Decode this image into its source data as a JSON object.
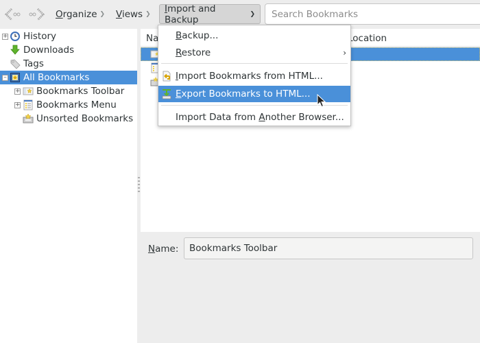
{
  "toolbar": {
    "back_icon": "back-arrow-icon",
    "forward_icon": "forward-arrow-icon",
    "organize": {
      "prefix": "",
      "accel": "O",
      "rest": "rganize"
    },
    "views": {
      "prefix": "",
      "accel": "V",
      "rest": "iews"
    },
    "import_backup": {
      "prefix": "",
      "accel": "I",
      "rest": "mport and Backup"
    },
    "search_placeholder": "Search Bookmarks",
    "search_value": ""
  },
  "sidebar": {
    "items": [
      {
        "label": "History",
        "icon": "clock-icon",
        "expandable": true
      },
      {
        "label": "Downloads",
        "icon": "download-arrow-icon",
        "expandable": false
      },
      {
        "label": "Tags",
        "icon": "tag-icon",
        "expandable": false
      },
      {
        "label": "All Bookmarks",
        "icon": "bookmarks-library-icon",
        "expandable": true,
        "expanded": true,
        "selected": true
      },
      {
        "label": "Bookmarks Toolbar",
        "icon": "bookmarks-toolbar-icon",
        "expandable": true
      },
      {
        "label": "Bookmarks Menu",
        "icon": "bookmarks-menu-icon",
        "expandable": true
      },
      {
        "label": "Unsorted Bookmarks",
        "icon": "unsorted-bookmarks-icon",
        "expandable": false
      }
    ]
  },
  "list": {
    "columns": {
      "name": "Name",
      "location": "Location"
    },
    "rows": [
      {
        "icon": "bookmarks-toolbar-icon",
        "selected": true
      },
      {
        "icon": "bookmarks-menu-icon",
        "selected": false
      },
      {
        "icon": "unsorted-bookmarks-icon",
        "selected": false
      }
    ]
  },
  "details": {
    "name_label": {
      "accel": "N",
      "rest": "ame:"
    },
    "name_value": "Bookmarks Toolbar"
  },
  "menu": {
    "items": [
      {
        "pre": "",
        "accel": "B",
        "post": "ackup...",
        "submenu": false
      },
      {
        "pre": "",
        "accel": "R",
        "post": "estore",
        "submenu": true,
        "arrow": "›"
      },
      {
        "pre": "",
        "accel": "I",
        "post": "mport Bookmarks from HTML...",
        "icon": "import-html-icon"
      },
      {
        "pre": "",
        "accel": "E",
        "post": "xport Bookmarks to HTML...",
        "icon": "export-html-icon",
        "highlighted": true
      },
      {
        "pre": "Import Data from ",
        "accel": "A",
        "post": "nother Browser..."
      }
    ]
  },
  "colors": {
    "selection": "#4a90d9",
    "background": "#ededed"
  }
}
